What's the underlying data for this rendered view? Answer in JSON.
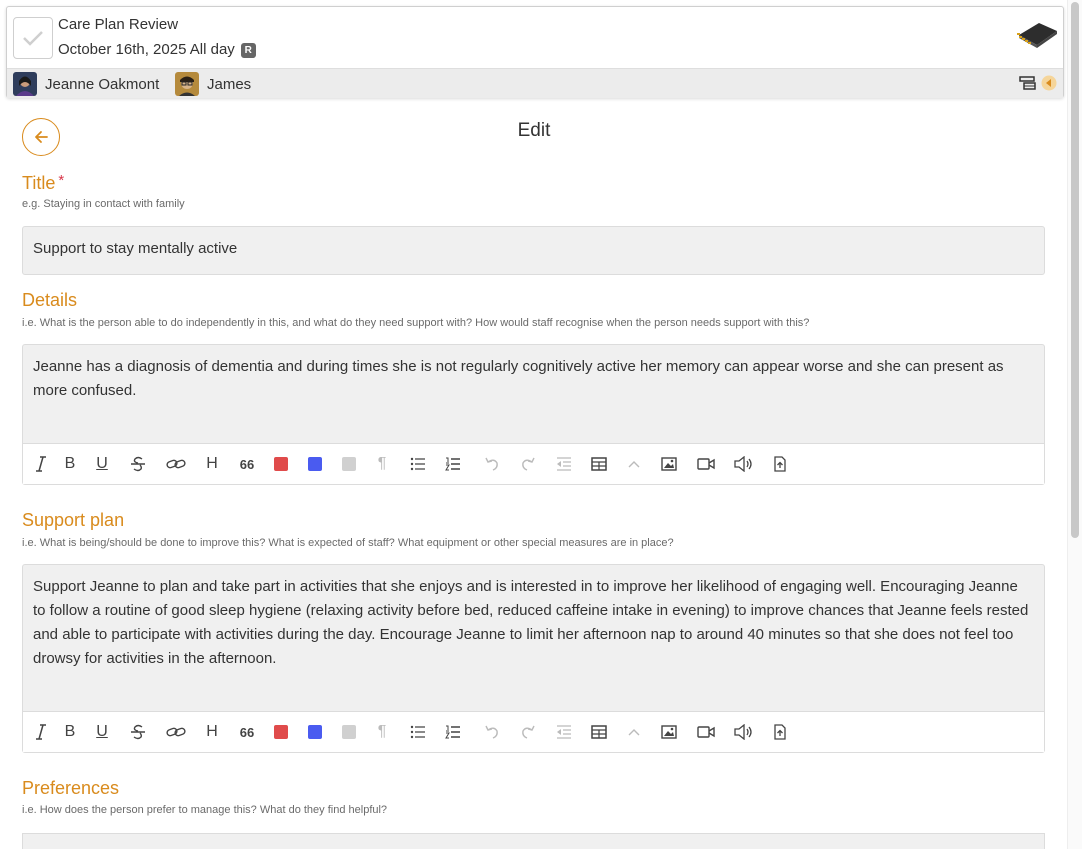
{
  "header": {
    "title": "Care Plan Review",
    "date": "October 16th, 2025 All day",
    "badge": "R",
    "people": [
      {
        "name": "Jeanne Oakmont"
      },
      {
        "name": "James"
      }
    ],
    "icons": [
      "check-icon",
      "chip-icon",
      "table-stack-icon",
      "expand-arrow-icon"
    ]
  },
  "page": {
    "title": "Edit"
  },
  "fields": {
    "title": {
      "label": "Title",
      "required_mark": "*",
      "hint": "e.g. Staying in contact with family",
      "value": "Support to stay mentally active"
    },
    "details": {
      "label": "Details",
      "hint": "i.e. What is the person able to do independently in this, and what do they need support with? How would staff recognise when the person needs support with this?",
      "value": "Jeanne has a diagnosis of dementia and during times she is not regularly cognitively active her memory can appear worse and she can present as more confused."
    },
    "support_plan": {
      "label": "Support plan",
      "hint": "i.e. What is being/should be done to improve this? What is expected of staff? What equipment or other special measures are in place?",
      "value": "Support Jeanne to plan and take part in activities that she enjoys and is interested in to improve her likelihood of engaging well. Encouraging Jeanne to follow a routine of good sleep hygiene (relaxing activity before bed, reduced caffeine intake in evening) to improve chances that Jeanne feels rested and able to participate with activities during the day. Encourage Jeanne to limit her afternoon nap to around 40 minutes so that she does not feel too drowsy for activities in the afternoon."
    },
    "preferences": {
      "label": "Preferences",
      "hint": "i.e. How does the person prefer to manage this? What do they find helpful?"
    }
  },
  "toolbar": {
    "bold": "B",
    "underline": "U",
    "heading": "H",
    "quote": "66",
    "paragraph": "¶",
    "colors": {
      "red": "#e04b4b",
      "blue": "#4a5bf0",
      "grey": "#d0d0d0"
    },
    "icons": [
      "italic-icon",
      "bold-icon",
      "underline-icon",
      "strikethrough-icon",
      "link-icon",
      "heading-icon",
      "quote-icon",
      "red-color-swatch",
      "blue-color-swatch",
      "grey-color-swatch",
      "paragraph-icon",
      "bullet-list-icon",
      "numbered-list-icon",
      "undo-icon",
      "redo-icon",
      "outdent-icon",
      "table-icon",
      "collapse-icon",
      "image-icon",
      "video-icon",
      "audio-icon",
      "file-upload-icon"
    ]
  },
  "colors": {
    "accent": "#d98b1d",
    "required": "#d9364a"
  }
}
